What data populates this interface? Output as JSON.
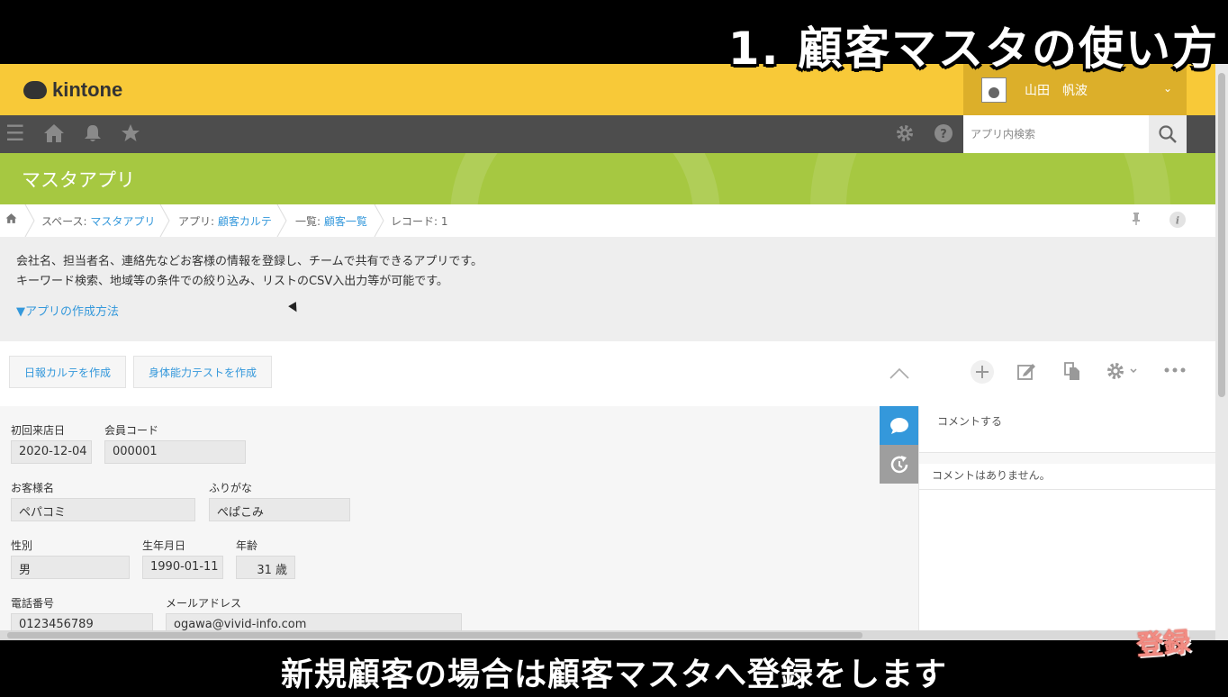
{
  "overlay": {
    "title": "1. 顧客マスタの使い方",
    "caption": "新規顧客の場合は顧客マスタへ登録をします",
    "stamp": "登録"
  },
  "header": {
    "logo_text": "kintone",
    "user_name": "山田　帆波"
  },
  "nav": {
    "search_placeholder": "アプリ内検索"
  },
  "app": {
    "title": "マスタアプリ"
  },
  "breadcrumb": {
    "space_prefix": "スペース: ",
    "space": "マスタアプリ",
    "app_prefix": "アプリ: ",
    "app": "顧客カルテ",
    "view_prefix": "一覧: ",
    "view": "顧客一覧",
    "record": "レコード: 1"
  },
  "description": {
    "line1": "会社名、担当者名、連絡先などお客様の情報を登録し、チームで共有できるアプリです。",
    "line2": "キーワード検索、地域等の条件での絞り込み、リストのCSV入出力等が可能です。",
    "toggle": "▼アプリの作成方法"
  },
  "toolbar": {
    "button1": "日報カルテを作成",
    "button2": "身体能力テストを作成"
  },
  "record": {
    "first_visit_label": "初回来店日",
    "first_visit": "2020-12-04",
    "member_code_label": "会員コード",
    "member_code": "000001",
    "customer_name_label": "お客様名",
    "customer_name": "ペパコミ",
    "furigana_label": "ふりがな",
    "furigana": "ぺぱこみ",
    "gender_label": "性別",
    "gender": "男",
    "birthday_label": "生年月日",
    "birthday": "1990-01-11",
    "age_label": "年齢",
    "age": "31 歳",
    "phone_label": "電話番号",
    "phone": "0123456789",
    "email_label": "メールアドレス",
    "email": "ogawa@vivid-info.com"
  },
  "comments": {
    "input_placeholder": "コメントする",
    "empty": "コメントはありません。"
  },
  "colors": {
    "header": "#f8c938",
    "nav": "#4d4d4d",
    "appbar": "#a6c841",
    "link": "#3498db",
    "comment_tab": "#3498db"
  }
}
